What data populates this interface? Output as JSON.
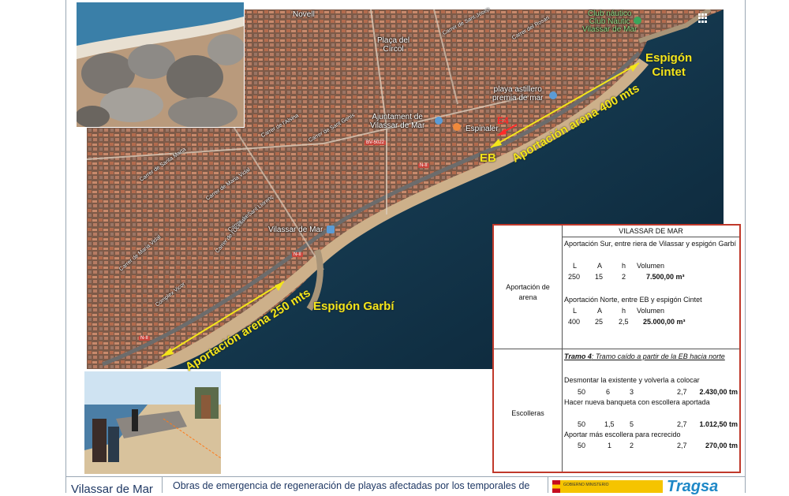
{
  "map": {
    "labels": {
      "novell": "Novell",
      "placa_del_circol": "Plaça del\nCírcol",
      "club_nautico": "Club náutico\nClub Náutic\nVilassar de Mar",
      "playa_astillero": "playa astillero\npremia de mar",
      "ajuntament": "Ajuntament de\nVilassar de Mar",
      "espinaler": "Espinaler",
      "vilassar_de_mar_station": "Vilassar de Mar",
      "road_bv5022": "BV-5022",
      "road_n2": "N-II",
      "carrer_sant_josep": "Carrer de Sant Josep",
      "carrer_del_rosari": "Carrer del Rosari",
      "carrer_de_l_alsina": "Carrer de l'Alsina",
      "carrer_de_santa_marta": "Carrer de Santa Marta",
      "carrer_de_maria_vidal": "Carrer de Maria Vidal",
      "carrer_de_sant_llorenc": "Carrer de Sant Llorenç",
      "carrer_de_sant_genis": "Carrer de Sant Genís",
      "carrer_de_l_ocellaire": "Carrer de l'Ocellaire",
      "complex_vicor": "Complex Vicor",
      "via_augusta": "Via Augusta"
    },
    "annotations": {
      "espigon_cintet": "Espigón\nCintet",
      "aportacion_400": "Aportación arena 400 mts",
      "eb": "EB",
      "e4": "E4",
      "espigon_garbi": "Espigón Garbí",
      "aportacion_250": "Aportación arena 250 mts"
    },
    "colors": {
      "sea": "#0f2d44",
      "land": "#8a6f5c",
      "annotation": "#f3e51b",
      "marker": "#ff2a2a"
    }
  },
  "table": {
    "title": "VILASSAR DE MAR",
    "rows": [
      {
        "label": "Aportación de\narena",
        "blocks": [
          {
            "heading": "Aportación Sur, entre riera de Vilassar y espigón Garbí",
            "cols": [
              "L",
              "A",
              "h",
              "Volumen"
            ],
            "values": [
              "250",
              "15",
              "2",
              "7.500,00 m³"
            ]
          },
          {
            "heading": "Aportación Norte, entre EB y espigón Cintet",
            "cols": [
              "L",
              "A",
              "h",
              "Volumen"
            ],
            "values": [
              "400",
              "25",
              "2,5",
              "25.000,00 m³"
            ]
          }
        ]
      },
      {
        "label": "Escolleras",
        "tramo_title": "Tramo 4",
        "tramo_desc": ": Tramo caído a partir de la EB hacia norte",
        "items": [
          {
            "desc": "Desmontar la existente y volverla a colocar",
            "values": [
              "50",
              "6",
              "3",
              "2,7",
              "2.430,00 tm"
            ]
          },
          {
            "desc": "Hacer nueva banqueta con escollera aportada",
            "values": [
              "50",
              "1,5",
              "5",
              "2,7",
              "1.012,50 tm"
            ]
          },
          {
            "desc": "Aportar más escollera para recrecido",
            "values": [
              "50",
              "1",
              "2",
              "2,7",
              "270,00 tm"
            ]
          }
        ]
      }
    ]
  },
  "footer": {
    "left": "Vilassar de Mar",
    "title": "Obras de emergencia de regeneración de playas afectadas por los temporales de",
    "gov_logo": "GOBIERNO MINISTERIO",
    "tragsa_logo": "Tragsa"
  }
}
